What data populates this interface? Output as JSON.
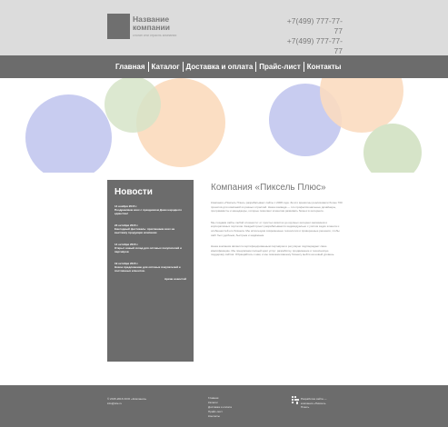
{
  "header": {
    "company_name_line1": "Название",
    "company_name_line2": "компании",
    "slogan": "слоган или отрасль компании",
    "phone1": "+7(499) 777-77-77",
    "phone2": "+7(499) 777-77-77"
  },
  "nav": {
    "items": [
      "Главная",
      "Каталог",
      "Доставка и оплата",
      "Прайс-лист",
      "Контакты"
    ]
  },
  "banner": {
    "colors": {
      "blue": "#c8ccf0",
      "orange": "#fbdcc0",
      "green": "#d6e4c8"
    }
  },
  "sidebar": {
    "title": "Новости",
    "news": [
      {
        "date": "14 ноября 2015 г.",
        "text": "Поздравляем всех с праздником Днем народного единства!"
      },
      {
        "date": "23 октября 2015 г.",
        "text": "Ежегодный фестиваль: приглашаем всех на выставку продукции компании"
      },
      {
        "date": "14 октября 2015 г.",
        "text": "Открыт новый склад для оптовых покупателей и партнёров"
      },
      {
        "date": "19 октября 2015 г.",
        "text": "Новое предложение для оптовых покупателей и постоянных клиентов."
      }
    ],
    "archive_link": "Архив новостей"
  },
  "content": {
    "title": "Компания «Пиксель Плюс»",
    "paragraphs": [
      "Компания «Пиксель Плюс» разрабатывает сайты с 2008 года. За это время мы реализовали более 700 проектов для компаний из разных отраслей. Наша команда — это профессиональные дизайнеры, программисты и менеджеры, которые помогают клиентам развивать бизнес в интернете.",
      "Мы создаём сайты любой сложности: от простых визиток до крупных интернет-магазинов и корпоративных порталов. Каждый проект разрабатывается индивидуально с учётом задач клиента и особенностей его бизнеса. Мы используем современные технологии и проверенные решения, чтобы сайт был удобным, быстрым и надёжным.",
      "Наша компания является сертифицированным партнёром и регулярно подтверждает свою квалификацию. Мы предлагаем полный цикл услуг: разработку, продвижение и техническую поддержку сайтов. Обращайтесь к нам, и мы поможем вашему бизнесу выйти на новый уровень."
    ]
  },
  "footer": {
    "copyright": "© 2015-2016 ООО «Компания»",
    "email": "info@site.ru",
    "links": [
      "Главная",
      "Каталог",
      "Доставка и оплата",
      "Прайс-лист",
      "Контакты"
    ],
    "developer_line1": "Разработка сайта —",
    "developer_line2": "компания «Пиксель",
    "developer_line3": "Плюс»"
  }
}
